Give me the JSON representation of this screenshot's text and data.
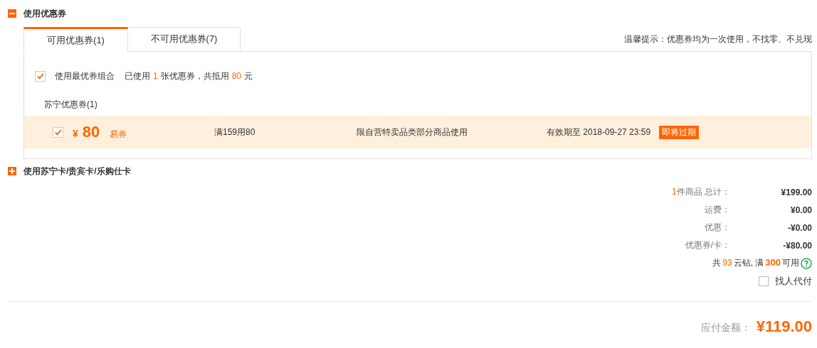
{
  "coupon_section": {
    "title": "使用优惠券",
    "expanded": true,
    "tabs": [
      {
        "label": "可用优惠券(1)",
        "selected": true
      },
      {
        "label": "不可用优惠券(7)",
        "selected": false
      }
    ],
    "tip": "温馨提示：优惠券均为一次使用，不找零、不兑现",
    "best_combo": {
      "checked": true,
      "label": "使用最优券组合",
      "summary": [
        {
          "kind": "plain",
          "text": "已使用"
        },
        {
          "kind": "highlight",
          "text": "1"
        },
        {
          "kind": "plain",
          "text": "张优惠券，共抵用"
        },
        {
          "kind": "highlight",
          "text": "80"
        },
        {
          "kind": "plain",
          "text": "元"
        }
      ]
    },
    "group_title": "苏宁优惠券(1)",
    "coupons": [
      {
        "checked": true,
        "currency": "¥",
        "amount": "80",
        "type": "易券",
        "condition": "满159用80",
        "scope": "限自营特卖品类部分商品使用",
        "validity": "有效期至 2018-09-27 23:59",
        "badge": "即将过期"
      }
    ]
  },
  "card_section": {
    "title": "使用苏宁卡/贵宾卡/乐购仕卡",
    "expanded": false
  },
  "summary": {
    "rows": [
      {
        "count": "1",
        "label": "件商品 总计：",
        "value": "¥199.00"
      },
      {
        "label": "运费：",
        "value": "¥0.00"
      },
      {
        "label": "优惠：",
        "value": "-¥0.00"
      },
      {
        "label": "优惠券/卡：",
        "value": "-¥80.00"
      }
    ],
    "points": [
      {
        "kind": "plain",
        "text": "共"
      },
      {
        "kind": "highlight",
        "text": "93"
      },
      {
        "kind": "plain",
        "text": "云钻, 满"
      },
      {
        "kind": "strong",
        "text": "300"
      },
      {
        "kind": "plain",
        "text": "可用"
      }
    ],
    "proxy_pay": {
      "checked": false,
      "label": "找人代付"
    },
    "total": {
      "label": "应付金额：",
      "value": "¥119.00"
    }
  }
}
